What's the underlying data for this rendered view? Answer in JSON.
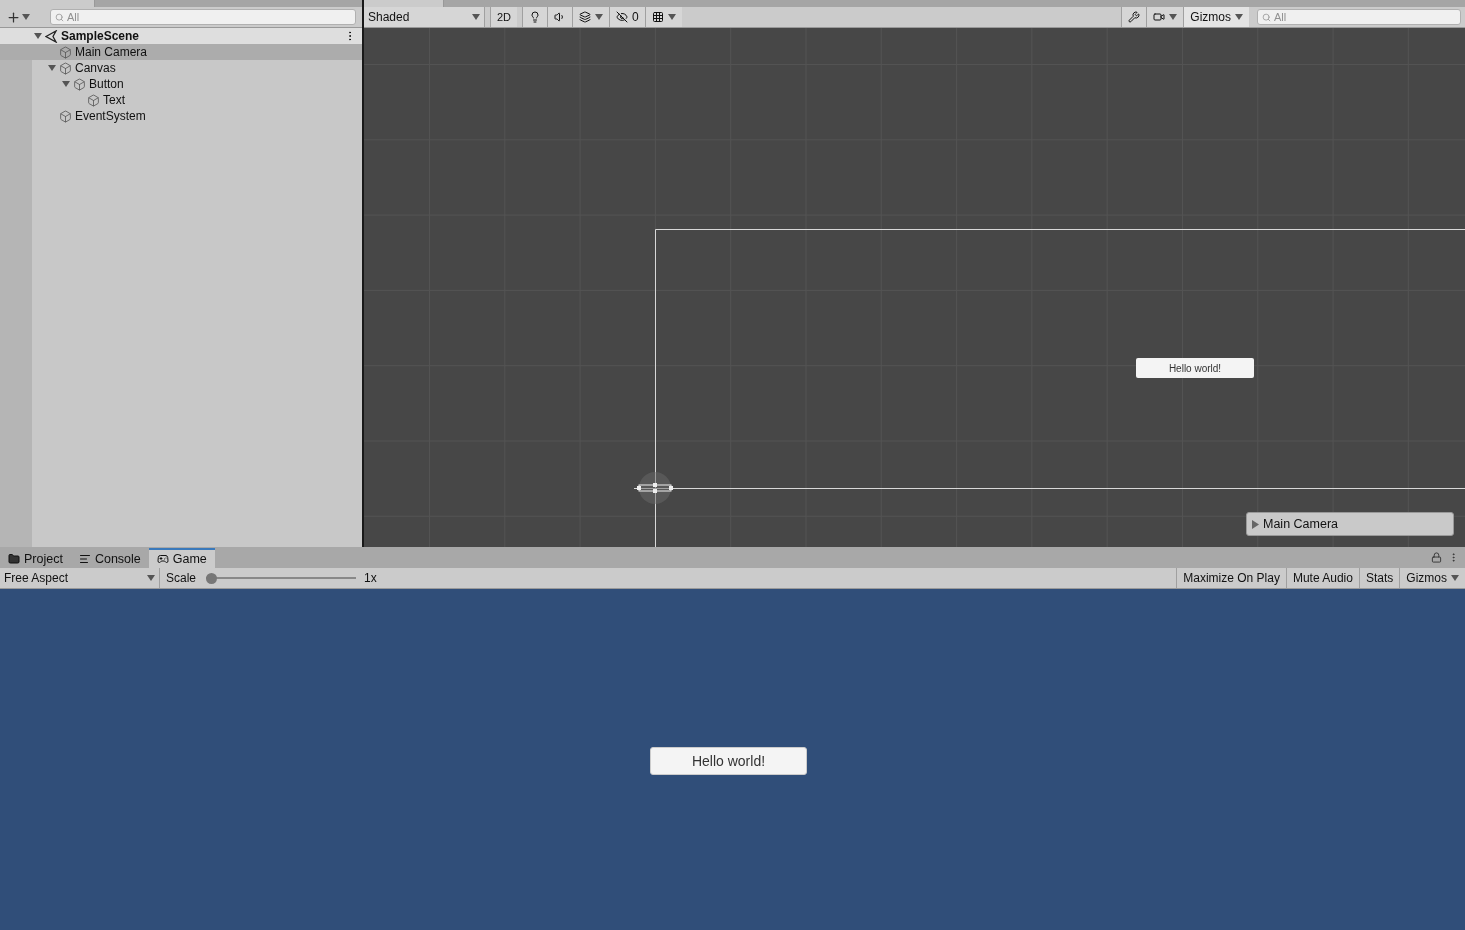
{
  "hierarchy": {
    "search": {
      "placeholder": "All"
    },
    "items": [
      {
        "label": "SampleScene",
        "kind": "scene",
        "selected": false,
        "expanded": true,
        "children": [
          {
            "label": "Main Camera",
            "kind": "object",
            "selected": true
          },
          {
            "label": "Canvas",
            "kind": "object",
            "selected": false,
            "expanded": true,
            "children": [
              {
                "label": "Button",
                "kind": "object",
                "selected": false,
                "expanded": true,
                "children": [
                  {
                    "label": "Text",
                    "kind": "object",
                    "selected": false
                  }
                ]
              }
            ]
          },
          {
            "label": "EventSystem",
            "kind": "object",
            "selected": false
          }
        ]
      }
    ]
  },
  "scene": {
    "toolbar": {
      "shading": "Shaded",
      "mode_button": "2D",
      "hidden_count": "0",
      "gizmos": "Gizmos",
      "search": {
        "placeholder": "All"
      }
    },
    "ui_button": "Hello world!",
    "camera_overlay": "Main Camera"
  },
  "bottom_tabs": [
    {
      "label": "Project",
      "selected": false
    },
    {
      "label": "Console",
      "selected": false
    },
    {
      "label": "Game",
      "selected": true
    }
  ],
  "game": {
    "toolbar": {
      "aspect": "Free Aspect",
      "scale_label": "Scale",
      "scale": {
        "level": 0
      },
      "scale_value": "1x",
      "toggles": [
        "Maximize On Play",
        "Mute Audio",
        "Stats"
      ],
      "gizmos": "Gizmos"
    },
    "ui_button": "Hello world!"
  }
}
